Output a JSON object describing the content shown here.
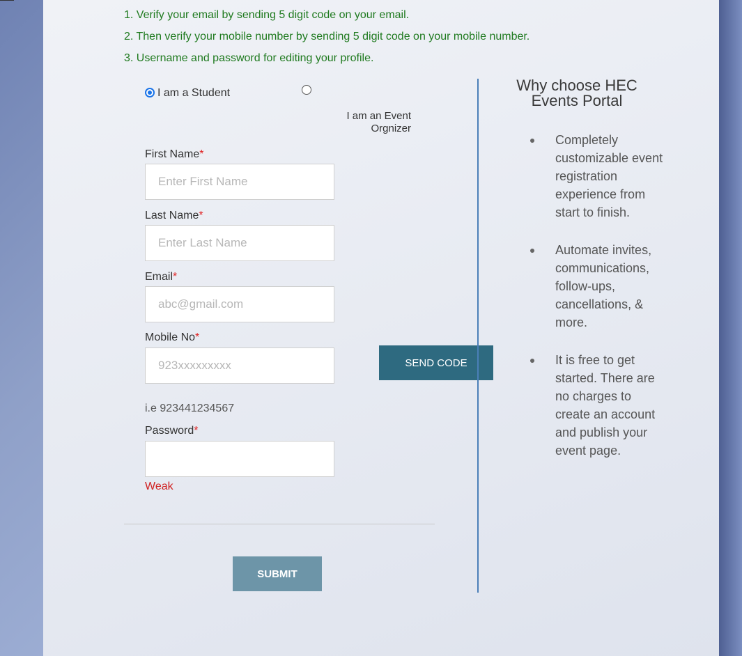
{
  "steps": [
    "1. Verify your email by sending 5 digit code on your email.",
    "2. Then verify your mobile number by sending 5 digit code on your mobile number.",
    "3. Username and password for editing your profile."
  ],
  "role": {
    "student_label": "I am a Student",
    "organizer_line1": "I am an Event",
    "organizer_line2": "Orgnizer",
    "selected": "student"
  },
  "form": {
    "first_name": {
      "label": "First Name",
      "required_mark": "*",
      "placeholder": "Enter First Name",
      "value": ""
    },
    "last_name": {
      "label": "Last Name",
      "required_mark": "*",
      "placeholder": "Enter Last Name",
      "value": ""
    },
    "email": {
      "label": "Email",
      "required_mark": "*",
      "placeholder": "abc@gmail.com",
      "value": ""
    },
    "mobile": {
      "label": "Mobile No",
      "required_mark": "*",
      "placeholder": "923xxxxxxxxx",
      "value": "",
      "hint": "i.e 923441234567"
    },
    "password": {
      "label": "Password",
      "required_mark": "*",
      "value": "",
      "strength": "Weak"
    },
    "send_code_label": "SEND CODE",
    "submit_label": "SUBMIT"
  },
  "why": {
    "title_line1": "Why choose HEC",
    "title_line2": "Events Portal",
    "items": [
      "Completely customizable event registration experience from start to finish.",
      "Automate invites, communications, follow-ups, cancellations, & more.",
      "It is free to get started. There are no charges to create an account and publish your event page."
    ]
  },
  "colors": {
    "steps_text": "#1f7a1f",
    "required": "#e02020",
    "send_code_bg": "#2e6a80",
    "submit_bg": "#6d95a8",
    "divider_blue": "#4b7fb8",
    "weak_text": "#d02020"
  }
}
